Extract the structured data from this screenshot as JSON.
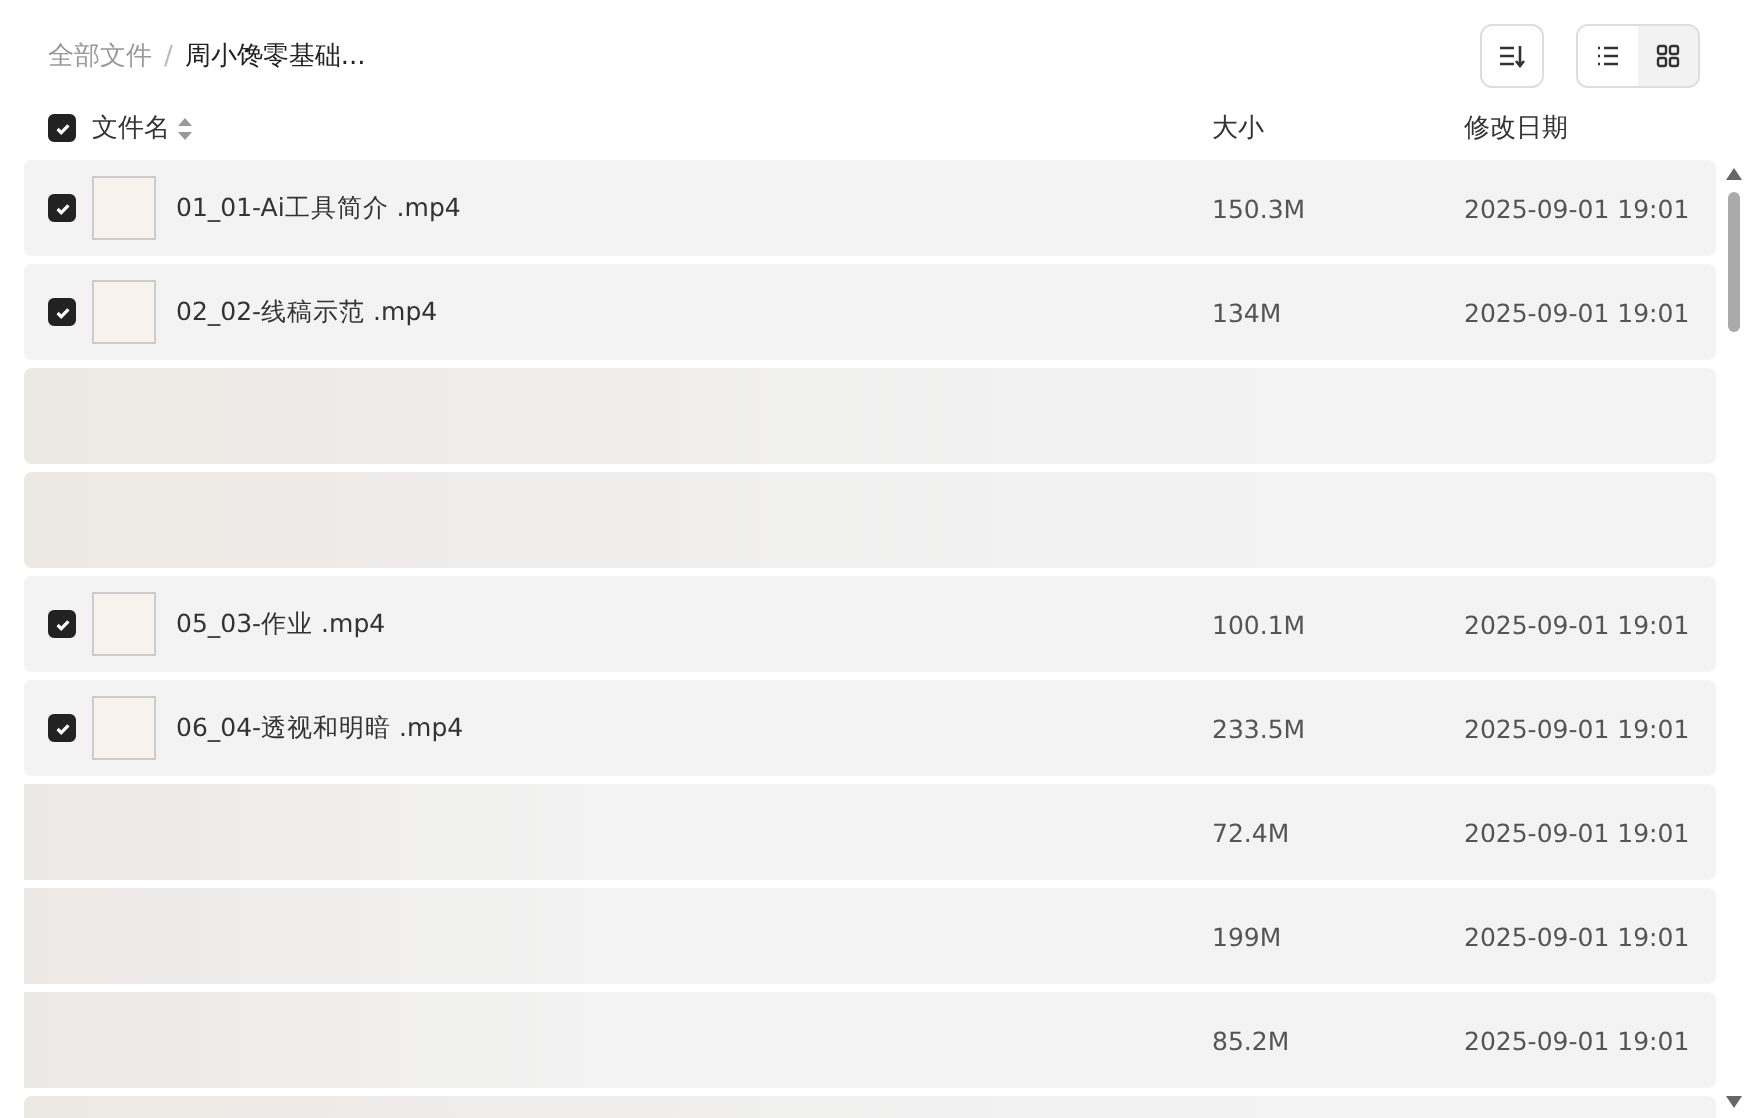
{
  "breadcrumb": [
    {
      "label": "全部文件",
      "current": false
    },
    {
      "label": "周小馋零基础...",
      "current": true
    }
  ],
  "breadcrumb_separator": "/",
  "view_toggle": [
    {
      "kind": "list",
      "selected": true
    },
    {
      "kind": "grid",
      "selected": false
    }
  ],
  "header": {
    "checked": true,
    "name": "文件名",
    "size": "大小",
    "date": "修改日期"
  },
  "rows": [
    {
      "kind": "visible",
      "checked": true,
      "name": "01_01-Ai工具简介 .mp4",
      "size": "150.3M",
      "date": "2025-09-01 19:01"
    },
    {
      "kind": "visible",
      "checked": true,
      "name": "02_02-线稿示范 .mp4",
      "size": "134M",
      "date": "2025-09-01 19:01"
    },
    {
      "kind": "hidden"
    },
    {
      "kind": "hidden"
    },
    {
      "kind": "visible",
      "checked": true,
      "name": "05_03-作业 .mp4",
      "size": "100.1M",
      "date": "2025-09-01 19:01"
    },
    {
      "kind": "visible",
      "checked": true,
      "name": "06_04-透视和明暗 .mp4",
      "size": "233.5M",
      "date": "2025-09-01 19:01"
    },
    {
      "kind": "name-hidden",
      "size": "72.4M",
      "date": "2025-09-01 19:01"
    },
    {
      "kind": "name-hidden",
      "size": "199M",
      "date": "2025-09-01 19:01"
    },
    {
      "kind": "name-hidden",
      "size": "85.2M",
      "date": "2025-09-01 19:01"
    },
    {
      "kind": "hidden"
    }
  ]
}
